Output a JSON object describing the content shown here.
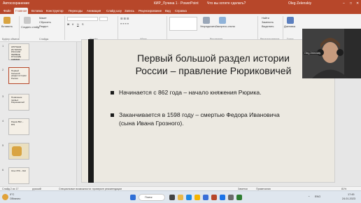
{
  "titlebar": {
    "autosave": "Автосохранение",
    "document": "КИР_Лучина 1 · PowerPoint",
    "search": "Что вы хотите сделать?",
    "user": "Oleg Zelenskiy"
  },
  "tabs": [
    "Файл",
    "Главная",
    "Вставка",
    "Конструктор",
    "Переходы",
    "Анимация",
    "Слайд шоу",
    "Запись",
    "Рецензирование",
    "Вид",
    "Справка"
  ],
  "ribbon": {
    "paste": "Вставить",
    "create_slide": "Создать слайд",
    "reset": "Сбросить",
    "section": "Раздел",
    "layout": "Макет",
    "arrange": "Упорядочить",
    "quick_styles": "Экспресс-стили",
    "find": "Найти",
    "replace": "Заменить",
    "select": "Выделить",
    "dictation": "Диктовка",
    "designer": "Конструктор",
    "groups": [
      "Буфер обмена",
      "Слайды",
      "Шрифт",
      "Абзац",
      "Рисование",
      "Редактирование",
      "Голос"
    ]
  },
  "slides": {
    "numbers": [
      "1",
      "2",
      "3",
      "4",
      "5",
      "6"
    ],
    "thumb_text": [
      "КРУПНАЯ ИСТОРИЯ РОССИИ: ПЕРВЫЕ РУССКИЕ КНЯЗЬЯ",
      "Первый большой раздел истории России",
      "Появление первых Рюриковичей",
      "Рюрик 862 – 879",
      "",
      "Олег 879 – 912"
    ]
  },
  "slide": {
    "title_line1": "Первый большой раздел истории",
    "title_line2": "России – правление Рюриковичей",
    "bullet1": "Начинается с 862 года – начало княжения Рюрика.",
    "bullet2_line1": "Заканчивается в 1598 году – смертью Федора Ивановича",
    "bullet2_line2": "(сына Ивана Грозного)."
  },
  "video": {
    "name": "Oleg Zelenskiy"
  },
  "status": {
    "slide": "Слайд 2 из 17",
    "lang": "русский",
    "accessibility": "Специальные возможности: проверьте рекомендации",
    "notes": "Заметки",
    "comments": "Примечания",
    "zoom": "81%"
  },
  "taskbar": {
    "weather_temp": "0°C",
    "weather_text": "Облачно",
    "search": "Поиск",
    "lang": "ENG",
    "time": "17:45",
    "date": "24.01.2023"
  },
  "colors": {
    "accent": "#b7472a",
    "slide_bg": "#ece9e1",
    "bar": "#1a1a1a"
  }
}
